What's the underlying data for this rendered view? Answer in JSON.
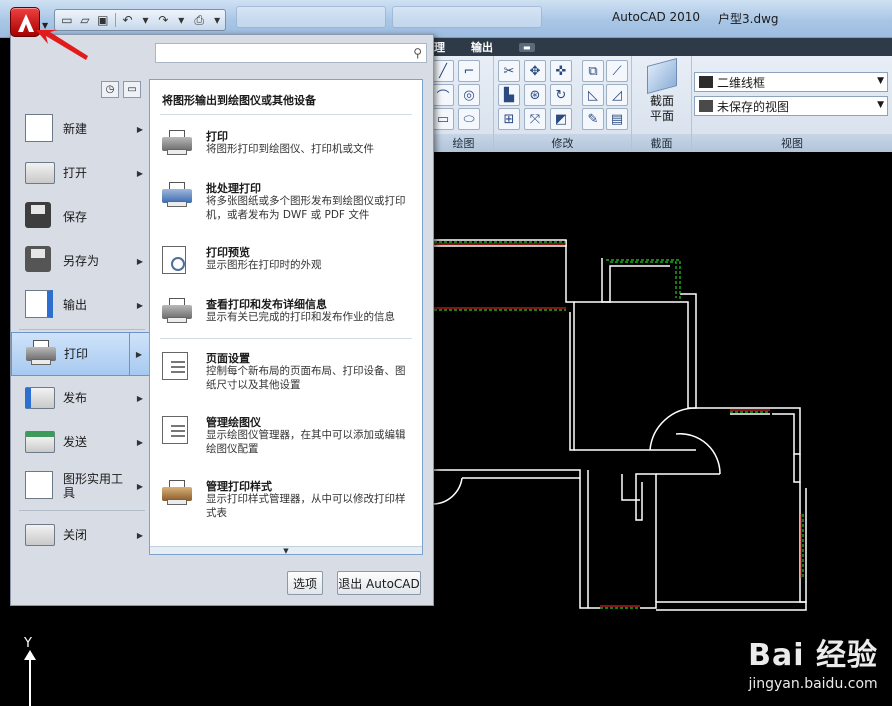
{
  "titlebar": {
    "app_title": "AutoCAD 2010",
    "doc_title": "户型3.dwg"
  },
  "ribbon": {
    "tabs": [
      "理",
      "输出"
    ],
    "panels": {
      "draw": "绘图",
      "modify": "修改",
      "section": "截面",
      "view": "视图"
    },
    "section_button": "截面\n平面",
    "visual_style": "二维线框",
    "saved_view": "未保存的视图"
  },
  "app_menu": {
    "search_placeholder": "",
    "items": [
      {
        "label": "新建",
        "has_arrow": true,
        "icon": "new-doc-icon"
      },
      {
        "label": "打开",
        "has_arrow": true,
        "icon": "open-folder-icon"
      },
      {
        "label": "保存",
        "has_arrow": false,
        "icon": "save-disk-icon"
      },
      {
        "label": "另存为",
        "has_arrow": true,
        "icon": "save-as-icon"
      },
      {
        "label": "输出",
        "has_arrow": true,
        "icon": "export-icon"
      },
      {
        "label": "打印",
        "has_arrow": true,
        "icon": "print-icon",
        "active": true
      },
      {
        "label": "发布",
        "has_arrow": true,
        "icon": "publish-icon"
      },
      {
        "label": "发送",
        "has_arrow": true,
        "icon": "send-icon"
      },
      {
        "label": "图形实用工具",
        "has_arrow": true,
        "icon": "drawing-utilities-icon"
      },
      {
        "label": "关闭",
        "has_arrow": true,
        "icon": "close-folder-icon"
      }
    ],
    "right_panel": {
      "heading": "将图形输出到绘图仪或其他设备",
      "items": [
        {
          "title": "打印",
          "desc": "将图形打印到绘图仪、打印机或文件"
        },
        {
          "title": "批处理打印",
          "desc": "将多张图纸或多个图形发布到绘图仪或打印机，或者发布为 DWF 或 PDF 文件"
        },
        {
          "title": "打印预览",
          "desc": "显示图形在打印时的外观"
        },
        {
          "title": "查看打印和发布详细信息",
          "desc": "显示有关已完成的打印和发布作业的信息"
        },
        {
          "title": "页面设置",
          "desc": "控制每个新布局的页面布局、打印设备、图纸尺寸以及其他设置"
        },
        {
          "title": "管理绘图仪",
          "desc": "显示绘图仪管理器，在其中可以添加或编辑绘图仪配置"
        },
        {
          "title": "管理打印样式",
          "desc": "显示打印样式管理器，从中可以修改打印样式表"
        }
      ]
    },
    "options_button": "选项",
    "exit_button": "退出 AutoCAD"
  },
  "drawing": {
    "y_axis_label": "Y",
    "watermark_top": "Bai 经验",
    "watermark_bottom": "jingyan.baidu.com"
  },
  "colors": {
    "accent_red": "#c00000",
    "active_blue": "#a7c9f0",
    "wall_white": "#ffffff",
    "window_green": "#22cc22"
  }
}
